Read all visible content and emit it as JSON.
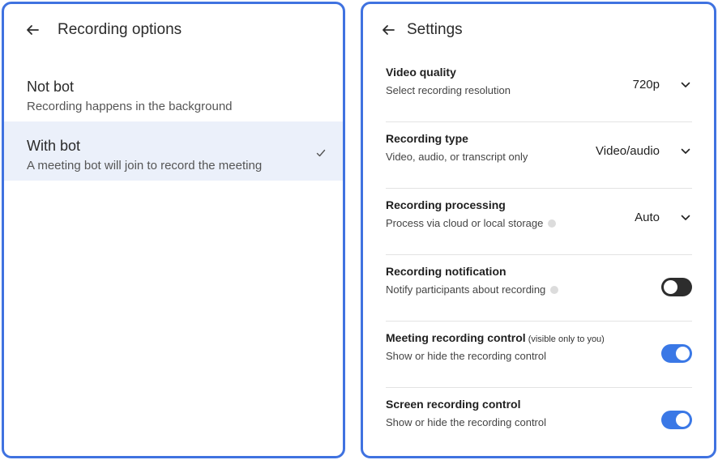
{
  "left": {
    "title": "Recording options",
    "options": [
      {
        "title": "Not bot",
        "desc": "Recording happens in the background",
        "selected": false
      },
      {
        "title": "With bot",
        "desc": "A meeting bot will join to record the meeting",
        "selected": true
      }
    ]
  },
  "right": {
    "title": "Settings",
    "rows": [
      {
        "title": "Video quality",
        "desc": "Select recording resolution",
        "value": "720p"
      },
      {
        "title": "Recording type",
        "desc": "Video, audio, or transcript only",
        "value": "Video/audio"
      },
      {
        "title": "Recording processing",
        "desc": "Process via cloud or local storage",
        "value": "Auto"
      },
      {
        "title": "Recording notification",
        "desc": "Notify participants about recording",
        "toggle": false
      },
      {
        "title": "Meeting recording control",
        "aside": "(visible only to you)",
        "desc": "Show or hide the recording control",
        "toggle": true
      },
      {
        "title": "Screen recording control",
        "desc": "Show or hide the recording control",
        "toggle": true
      }
    ]
  },
  "colors": {
    "accent": "#3a78e6",
    "border": "#3f72e0",
    "selected_bg": "#ebf0fa",
    "toggle_off": "#2d2d2d"
  },
  "icons": {
    "back": "arrow-left-icon",
    "check": "check-icon",
    "dropdown": "chevron-down-icon",
    "info": "info-icon"
  }
}
